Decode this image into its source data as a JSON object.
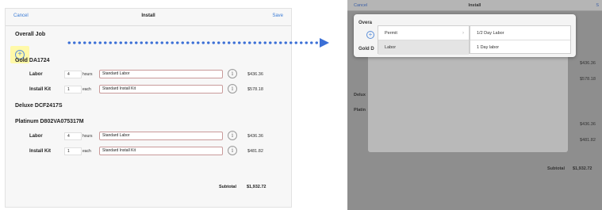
{
  "left": {
    "nav": {
      "cancel": "Cancel",
      "title": "Install",
      "save": "Save"
    },
    "overall_job": "Overall Job",
    "add_icon": "plus-circle-icon",
    "sections": [
      {
        "title": "Gold DA1724",
        "rows": [
          {
            "label": "Labor",
            "qty": "4",
            "unit": "hours",
            "option": "Standard Labor",
            "price": "$436.36"
          },
          {
            "label": "Install Kit",
            "qty": "1",
            "unit": "each",
            "option": "Standard Install Kit",
            "price": "$578.18"
          }
        ]
      },
      {
        "title": "Deluxe DCF2417S",
        "rows": []
      },
      {
        "title": "Platinum D802VA075317M",
        "rows": [
          {
            "label": "Labor",
            "qty": "4",
            "unit": "hours",
            "option": "Standard Labor",
            "price": "$436.36"
          },
          {
            "label": "Install Kit",
            "qty": "1",
            "unit": "each",
            "option": "Standard Install Kit",
            "price": "$481.82"
          }
        ]
      }
    ],
    "subtotal_label": "Subtotal",
    "subtotal_value": "$1,932.72"
  },
  "right": {
    "nav": {
      "cancel": "Cancel",
      "title": "Install",
      "save": "S"
    },
    "popover": {
      "side_labels": [
        "Overa",
        "Gold D"
      ],
      "col1": [
        "Permit",
        "Labor"
      ],
      "col2": [
        "1/2 Day Labor",
        "1 Day labor"
      ],
      "selected_index": 1
    },
    "behind": {
      "deluxe": "Delux",
      "platinum": "Platin",
      "prices": [
        "$436.36",
        "$578.18",
        "$436.36",
        "$481.82"
      ],
      "subtotal_label": "Subtotal",
      "subtotal_value": "$1,932.72"
    }
  },
  "colors": {
    "accent": "#3a7bd5",
    "highlight": "#fff9a8",
    "arrow": "#3b6fd6"
  }
}
